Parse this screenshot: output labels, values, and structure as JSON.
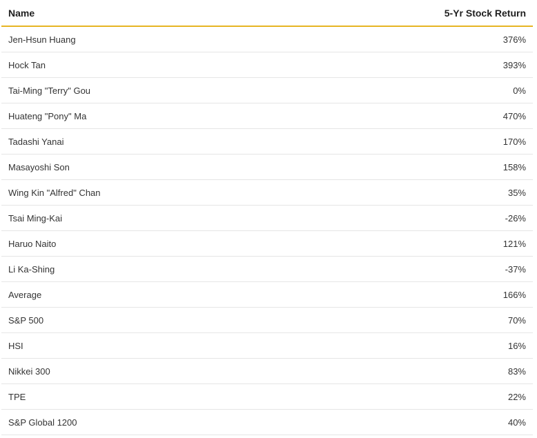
{
  "chart_data": {
    "type": "table",
    "columns": [
      "Name",
      "5-Yr Stock Return"
    ],
    "rows": [
      {
        "name": "Jen-Hsun Huang",
        "value": "376%"
      },
      {
        "name": "Hock Tan",
        "value": "393%"
      },
      {
        "name": "Tai-Ming \"Terry\" Gou",
        "value": "0%"
      },
      {
        "name": "Huateng \"Pony\" Ma",
        "value": "470%"
      },
      {
        "name": "Tadashi Yanai",
        "value": "170%"
      },
      {
        "name": "Masayoshi Son",
        "value": "158%"
      },
      {
        "name": "Wing Kin \"Alfred\" Chan",
        "value": "35%"
      },
      {
        "name": "Tsai Ming-Kai",
        "value": "-26%"
      },
      {
        "name": "Haruo Naito",
        "value": "121%"
      },
      {
        "name": "Li Ka-Shing",
        "value": "-37%"
      },
      {
        "name": "Average",
        "value": "166%"
      },
      {
        "name": "S&P 500",
        "value": "70%"
      },
      {
        "name": "HSI",
        "value": "16%"
      },
      {
        "name": "Nikkei 300",
        "value": "83%"
      },
      {
        "name": "TPE",
        "value": "22%"
      },
      {
        "name": "S&P Global 1200",
        "value": "40%"
      }
    ]
  },
  "colors": {
    "header_rule": "#e6b422",
    "row_rule": "#e5e5e5",
    "text": "#333333"
  }
}
